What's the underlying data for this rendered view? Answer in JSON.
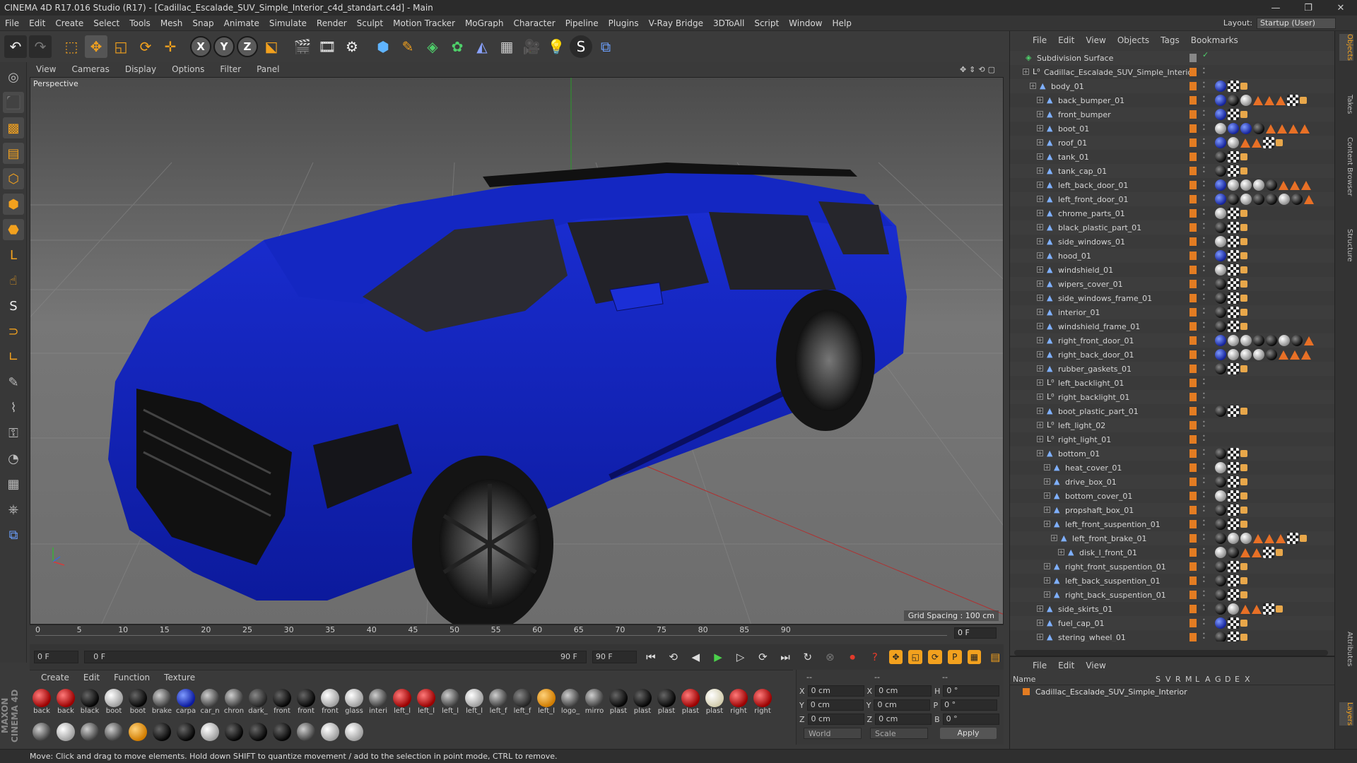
{
  "window": {
    "title": "CINEMA 4D R17.016 Studio (R17) - [Cadillac_Escalade_SUV_Simple_Interior_c4d_standart.c4d] - Main"
  },
  "menu": [
    "File",
    "Edit",
    "Create",
    "Select",
    "Tools",
    "Mesh",
    "Snap",
    "Animate",
    "Simulate",
    "Render",
    "Sculpt",
    "Motion Tracker",
    "MoGraph",
    "Character",
    "Pipeline",
    "Plugins",
    "V-Ray Bridge",
    "3DToAll",
    "Script",
    "Window",
    "Help"
  ],
  "layout": {
    "label": "Layout:",
    "value": "Startup (User)"
  },
  "viewport": {
    "menu": [
      "View",
      "Cameras",
      "Display",
      "Options",
      "Filter",
      "Panel"
    ],
    "label": "Perspective",
    "grid_spacing": "Grid Spacing : 100 cm"
  },
  "timeline": {
    "ticks": [
      "0",
      "5",
      "10",
      "15",
      "20",
      "25",
      "30",
      "35",
      "40",
      "45",
      "50",
      "55",
      "60",
      "65",
      "70",
      "75",
      "80",
      "85",
      "90"
    ],
    "current": "0 F",
    "start_field": "0 F",
    "range_start": "0 F",
    "range_end": "90 F",
    "end_field": "90 F"
  },
  "materials": {
    "menu": [
      "Create",
      "Edit",
      "Function",
      "Texture"
    ],
    "row1": [
      {
        "label": "back",
        "color": "red"
      },
      {
        "label": "back",
        "color": "red"
      },
      {
        "label": "black",
        "color": "black"
      },
      {
        "label": "boot",
        "color": "white"
      },
      {
        "label": "boot",
        "color": "black"
      },
      {
        "label": "brake",
        "color": "grey"
      },
      {
        "label": "carpa",
        "color": "blue"
      },
      {
        "label": "car_n",
        "color": "grey"
      },
      {
        "label": "chron",
        "color": "grey"
      },
      {
        "label": "dark_",
        "color": "dgrey"
      },
      {
        "label": "front",
        "color": "black"
      },
      {
        "label": "front",
        "color": "black"
      },
      {
        "label": "front",
        "color": "white"
      },
      {
        "label": "glass",
        "color": "white"
      },
      {
        "label": "interi",
        "color": "grey"
      },
      {
        "label": "left_l",
        "color": "red"
      },
      {
        "label": "left_l",
        "color": "red"
      },
      {
        "label": "left_l",
        "color": "grey"
      },
      {
        "label": "left_l",
        "color": "white"
      },
      {
        "label": "left_f",
        "color": "grey"
      },
      {
        "label": "left_f",
        "color": "dgrey"
      },
      {
        "label": "left_l",
        "color": "orange"
      },
      {
        "label": "logo_",
        "color": "grey"
      },
      {
        "label": "mirro",
        "color": "grey"
      },
      {
        "label": "plast",
        "color": "black"
      },
      {
        "label": "plast",
        "color": "black"
      },
      {
        "label": "plast",
        "color": "black"
      },
      {
        "label": "plast",
        "color": "red"
      },
      {
        "label": "plast",
        "color": "cream"
      },
      {
        "label": "right",
        "color": "red"
      },
      {
        "label": "right",
        "color": "red"
      }
    ],
    "row2": [
      {
        "color": "grey"
      },
      {
        "color": "white"
      },
      {
        "color": "grey"
      },
      {
        "color": "grey"
      },
      {
        "color": "orange"
      },
      {
        "color": "black"
      },
      {
        "color": "black"
      },
      {
        "color": "white"
      },
      {
        "color": "black"
      },
      {
        "color": "black"
      },
      {
        "color": "black"
      },
      {
        "color": "grey"
      },
      {
        "color": "white"
      },
      {
        "color": "white"
      }
    ]
  },
  "coords": {
    "header": [
      "--",
      "--",
      "--"
    ],
    "rows": [
      {
        "a": "X",
        "av": "0 cm",
        "b": "X",
        "bv": "0 cm",
        "c": "H",
        "cv": "0 °"
      },
      {
        "a": "Y",
        "av": "0 cm",
        "b": "Y",
        "bv": "0 cm",
        "c": "P",
        "cv": "0 °"
      },
      {
        "a": "Z",
        "av": "0 cm",
        "b": "Z",
        "bv": "0 cm",
        "c": "B",
        "cv": "0 °"
      }
    ],
    "mode": "World",
    "scale": "Scale",
    "apply": "Apply"
  },
  "objects": {
    "menu": [
      "File",
      "Edit",
      "View",
      "Objects",
      "Tags",
      "Bookmarks"
    ],
    "tree": [
      {
        "name": "Subdivision Surface",
        "depth": 0,
        "icon": "subdiv",
        "tags": []
      },
      {
        "name": "Cadillac_Escalade_SUV_Simple_Interior",
        "depth": 1,
        "icon": "null",
        "tags": []
      },
      {
        "name": "body_01",
        "depth": 2,
        "icon": "poly",
        "tags": [
          "b",
          "c",
          "d"
        ]
      },
      {
        "name": "back_bumper_01",
        "depth": 3,
        "icon": "poly",
        "tags": [
          "b",
          "k",
          "w",
          "t",
          "t",
          "t",
          "c",
          "d"
        ]
      },
      {
        "name": "front_bumper",
        "depth": 3,
        "icon": "poly",
        "tags": [
          "b",
          "c",
          "d"
        ]
      },
      {
        "name": "boot_01",
        "depth": 3,
        "icon": "poly",
        "tags": [
          "w",
          "b",
          "b",
          "k",
          "t",
          "t",
          "t",
          "t"
        ]
      },
      {
        "name": "roof_01",
        "depth": 3,
        "icon": "poly",
        "tags": [
          "b",
          "w",
          "t",
          "t",
          "c",
          "d"
        ]
      },
      {
        "name": "tank_01",
        "depth": 3,
        "icon": "poly",
        "tags": [
          "k",
          "c",
          "d"
        ]
      },
      {
        "name": "tank_cap_01",
        "depth": 3,
        "icon": "poly",
        "tags": [
          "k",
          "c",
          "d"
        ]
      },
      {
        "name": "left_back_door_01",
        "depth": 3,
        "icon": "poly",
        "tags": [
          "b",
          "w",
          "w",
          "w",
          "k",
          "t",
          "t",
          "t"
        ]
      },
      {
        "name": "left_front_door_01",
        "depth": 3,
        "icon": "poly",
        "tags": [
          "b",
          "k",
          "w",
          "k",
          "k",
          "w",
          "k",
          "t"
        ]
      },
      {
        "name": "chrome_parts_01",
        "depth": 3,
        "icon": "poly",
        "tags": [
          "w",
          "c",
          "d"
        ]
      },
      {
        "name": "black_plastic_part_01",
        "depth": 3,
        "icon": "poly",
        "tags": [
          "k",
          "c",
          "d"
        ]
      },
      {
        "name": "side_windows_01",
        "depth": 3,
        "icon": "poly",
        "tags": [
          "w",
          "c",
          "d"
        ]
      },
      {
        "name": "hood_01",
        "depth": 3,
        "icon": "poly",
        "tags": [
          "b",
          "c",
          "d"
        ]
      },
      {
        "name": "windshield_01",
        "depth": 3,
        "icon": "poly",
        "tags": [
          "w",
          "c",
          "d"
        ]
      },
      {
        "name": "wipers_cover_01",
        "depth": 3,
        "icon": "poly",
        "tags": [
          "k",
          "c",
          "d"
        ]
      },
      {
        "name": "side_windows_frame_01",
        "depth": 3,
        "icon": "poly",
        "tags": [
          "k",
          "c",
          "d"
        ]
      },
      {
        "name": "interior_01",
        "depth": 3,
        "icon": "poly",
        "tags": [
          "k",
          "c",
          "d"
        ]
      },
      {
        "name": "windshield_frame_01",
        "depth": 3,
        "icon": "poly",
        "tags": [
          "k",
          "c",
          "d"
        ]
      },
      {
        "name": "right_front_door_01",
        "depth": 3,
        "icon": "poly",
        "tags": [
          "b",
          "w",
          "w",
          "k",
          "k",
          "w",
          "k",
          "t"
        ]
      },
      {
        "name": "right_back_door_01",
        "depth": 3,
        "icon": "poly",
        "tags": [
          "b",
          "w",
          "w",
          "w",
          "k",
          "t",
          "t",
          "t"
        ]
      },
      {
        "name": "rubber_gaskets_01",
        "depth": 3,
        "icon": "poly",
        "tags": [
          "k",
          "c",
          "d"
        ]
      },
      {
        "name": "left_backlight_01",
        "depth": 3,
        "icon": "null",
        "tags": []
      },
      {
        "name": "right_backlight_01",
        "depth": 3,
        "icon": "null",
        "tags": []
      },
      {
        "name": "boot_plastic_part_01",
        "depth": 3,
        "icon": "poly",
        "tags": [
          "k",
          "c",
          "d"
        ]
      },
      {
        "name": "left_light_02",
        "depth": 3,
        "icon": "null",
        "tags": []
      },
      {
        "name": "right_light_01",
        "depth": 3,
        "icon": "null",
        "tags": []
      },
      {
        "name": "bottom_01",
        "depth": 3,
        "icon": "poly",
        "tags": [
          "k",
          "c",
          "d"
        ]
      },
      {
        "name": "heat_cover_01",
        "depth": 4,
        "icon": "poly",
        "tags": [
          "w",
          "c",
          "d"
        ]
      },
      {
        "name": "drive_box_01",
        "depth": 4,
        "icon": "poly",
        "tags": [
          "k",
          "c",
          "d"
        ]
      },
      {
        "name": "bottom_cover_01",
        "depth": 4,
        "icon": "poly",
        "tags": [
          "w",
          "c",
          "d"
        ]
      },
      {
        "name": "propshaft_box_01",
        "depth": 4,
        "icon": "poly",
        "tags": [
          "k",
          "c",
          "d"
        ]
      },
      {
        "name": "left_front_suspention_01",
        "depth": 4,
        "icon": "poly",
        "tags": [
          "k",
          "c",
          "d"
        ]
      },
      {
        "name": "left_front_brake_01",
        "depth": 5,
        "icon": "poly",
        "tags": [
          "k",
          "w",
          "w",
          "t",
          "t",
          "t",
          "c",
          "d"
        ]
      },
      {
        "name": "disk_l_front_01",
        "depth": 6,
        "icon": "poly",
        "tags": [
          "w",
          "k",
          "t",
          "t",
          "c",
          "d"
        ]
      },
      {
        "name": "right_front_suspention_01",
        "depth": 4,
        "icon": "poly",
        "tags": [
          "k",
          "c",
          "d"
        ]
      },
      {
        "name": "left_back_suspention_01",
        "depth": 4,
        "icon": "poly",
        "tags": [
          "k",
          "c",
          "d"
        ]
      },
      {
        "name": "right_back_suspention_01",
        "depth": 4,
        "icon": "poly",
        "tags": [
          "k",
          "c",
          "d"
        ]
      },
      {
        "name": "side_skirts_01",
        "depth": 3,
        "icon": "poly",
        "tags": [
          "k",
          "w",
          "t",
          "t",
          "c",
          "d"
        ]
      },
      {
        "name": "fuel_cap_01",
        "depth": 3,
        "icon": "poly",
        "tags": [
          "b",
          "c",
          "d"
        ]
      },
      {
        "name": "stering_wheel_01",
        "depth": 3,
        "icon": "poly",
        "tags": [
          "k",
          "c",
          "d"
        ]
      }
    ]
  },
  "layers": {
    "menu": [
      "File",
      "Edit",
      "View"
    ],
    "columns": [
      "Name",
      "S",
      "V",
      "R",
      "M",
      "L",
      "A",
      "G",
      "D",
      "E",
      "X"
    ],
    "row": "Cadillac_Escalade_SUV_Simple_Interior"
  },
  "side_tabs": [
    "Objects",
    "Takes",
    "Content Browser",
    "Structure",
    "Attributes",
    "Layers"
  ],
  "brand": "MAXON CINEMA 4D",
  "status": "Move: Click and drag to move elements. Hold down SHIFT to quantize movement / add to the selection in point mode, CTRL to remove."
}
